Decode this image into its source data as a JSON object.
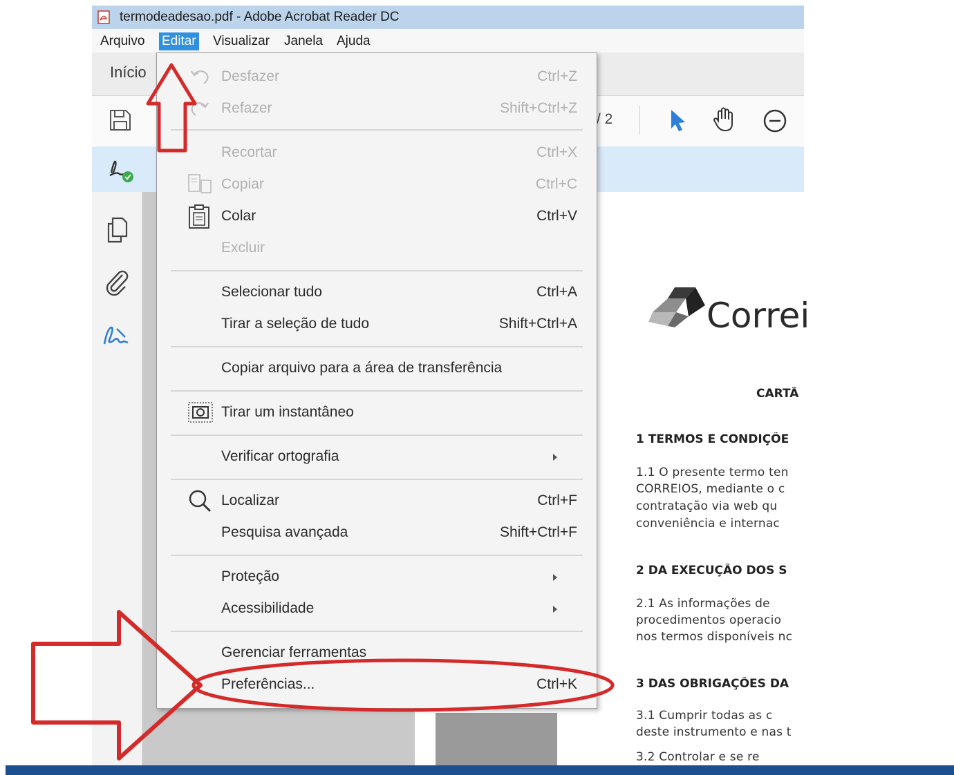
{
  "window": {
    "title": "termodeadesao.pdf - Adobe Acrobat Reader DC"
  },
  "menubar": {
    "items": [
      "Arquivo",
      "Editar",
      "Visualizar",
      "Janela",
      "Ajuda"
    ],
    "active": "Editar"
  },
  "tabs": {
    "home": "Início"
  },
  "toolbar": {
    "page_indicator": "/ 2"
  },
  "edit_menu": {
    "items": [
      {
        "label": "Desfazer",
        "shortcut": "Ctrl+Z",
        "enabled": false
      },
      {
        "label": "Refazer",
        "shortcut": "Shift+Ctrl+Z",
        "enabled": false
      },
      {
        "label": "Recortar",
        "shortcut": "Ctrl+X",
        "enabled": false
      },
      {
        "label": "Copiar",
        "shortcut": "Ctrl+C",
        "enabled": false
      },
      {
        "label": "Colar",
        "shortcut": "Ctrl+V",
        "enabled": true
      },
      {
        "label": "Excluir",
        "shortcut": "",
        "enabled": false
      },
      {
        "label": "Selecionar tudo",
        "shortcut": "Ctrl+A",
        "enabled": true
      },
      {
        "label": "Tirar a seleção de tudo",
        "shortcut": "Shift+Ctrl+A",
        "enabled": true
      },
      {
        "label": "Copiar arquivo para a área de transferência",
        "shortcut": "",
        "enabled": true
      },
      {
        "label": "Tirar um instantâneo",
        "shortcut": "",
        "enabled": true
      },
      {
        "label": "Verificar ortografia",
        "shortcut": "",
        "enabled": true,
        "submenu": true
      },
      {
        "label": "Localizar",
        "shortcut": "Ctrl+F",
        "enabled": true
      },
      {
        "label": "Pesquisa avançada",
        "shortcut": "Shift+Ctrl+F",
        "enabled": true
      },
      {
        "label": "Proteção",
        "shortcut": "",
        "enabled": true,
        "submenu": true
      },
      {
        "label": "Acessibilidade",
        "shortcut": "",
        "enabled": true,
        "submenu": true
      },
      {
        "label": "Gerenciar ferramentas",
        "shortcut": "",
        "enabled": true
      },
      {
        "label": "Preferências...",
        "shortcut": "Ctrl+K",
        "enabled": true,
        "highlighted": true
      }
    ]
  },
  "document": {
    "logo_text": "Correi",
    "heading": "CARTÃ",
    "sections": [
      {
        "title": "1   TERMOS E CONDIÇÕE",
        "lines": [
          "1.1 O presente termo ten",
          "CORREIOS, mediante o c",
          "contratação via web qu",
          "conveniência e internac"
        ]
      },
      {
        "title": "2   DA EXECUÇÃO DOS S",
        "lines": [
          "2.1   As informações de",
          "procedimentos operacio",
          "nos termos disponíveis nc"
        ]
      },
      {
        "title": "3   DAS OBRIGAÇÕES DA",
        "lines": [
          "3.1   Cumprir todas as c",
          "deste instrumento e nas t",
          "3.2   Controlar  e  se  re"
        ]
      }
    ]
  },
  "colors": {
    "accent": "#2f8fe0",
    "titlebar": "#bcd3ec",
    "sign_bar": "#d9ebfa",
    "annotation": "#d42a2a",
    "disabled_text": "#b1b1b1"
  },
  "icons": [
    "pdf-icon",
    "save-icon",
    "select-arrow-icon",
    "hand-icon",
    "zoom-out-icon",
    "fill-sign-icon",
    "pages-icon",
    "attachment-icon",
    "signature-icon",
    "undo-icon",
    "redo-icon",
    "copy-icon",
    "clipboard-icon",
    "camera-icon",
    "search-icon"
  ]
}
